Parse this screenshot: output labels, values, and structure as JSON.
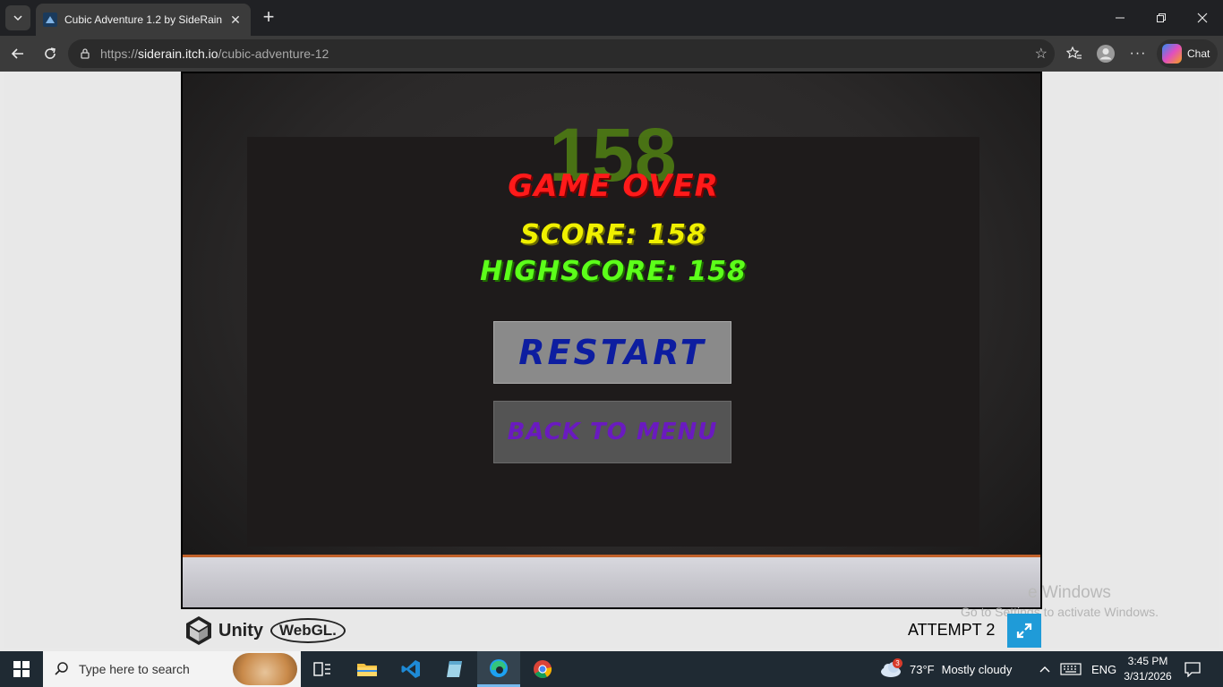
{
  "browser": {
    "tab_title": "Cubic Adventure 1.2 by SideRain",
    "url_prefix": "https://",
    "url_host": "siderain.itch.io",
    "url_path": "/cubic-adventure-12",
    "chat_label": "Chat"
  },
  "game": {
    "big_score": "158",
    "game_over_label": "GAME OVER",
    "score_text": "SCORE: 158",
    "highscore_text": "HIGHSCORE: 158",
    "restart_label": "RESTART",
    "back_to_menu_label": "BACK TO MENU",
    "attempt_text": "ATTEMPT 2",
    "engine_label": "Unity",
    "webgl_label": "WebGL."
  },
  "watermark": {
    "line1": "e Windows",
    "line2": "Go to Settings to activate Windows."
  },
  "taskbar": {
    "search_placeholder": "Type here to search",
    "weather_badge": "3",
    "temperature": "73°F",
    "weather_text": "Mostly cloudy",
    "language": "ENG",
    "time": "3:45 PM",
    "date": "3/31/2026"
  },
  "colors": {
    "game_over": "#ff1a1a",
    "score": "#f0f000",
    "highscore": "#5cff1a",
    "restart_text": "#0d1da0",
    "back_text": "#6a1ac0",
    "fullscreen_button": "#1f9bd8"
  }
}
